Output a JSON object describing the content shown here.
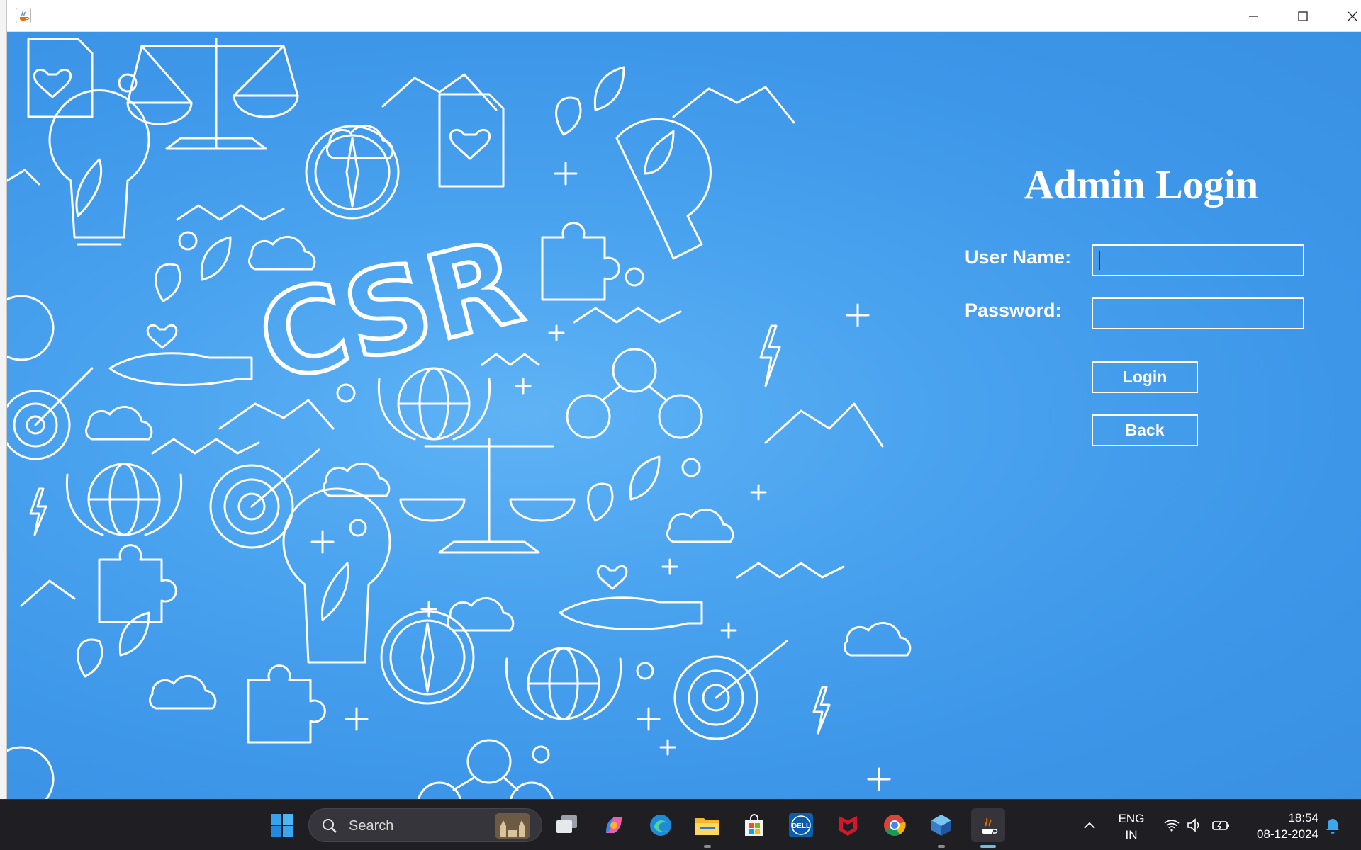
{
  "window": {
    "title": "",
    "icon": "java-cup-icon",
    "controls": [
      "minimize-icon",
      "maximize-icon",
      "close-icon"
    ]
  },
  "background": {
    "logo_text": "CSR",
    "colors": {
      "primary": "#4aa3ef",
      "light": "#5fb3f5",
      "line": "#ffffff"
    }
  },
  "login": {
    "title": "Admin Login",
    "username_label": "User Name:",
    "username_value": "",
    "password_label": "Password:",
    "password_value": "",
    "login_button": "Login",
    "back_button": "Back"
  },
  "taskbar": {
    "search_placeholder": "Search",
    "apps": [
      "windows-start-icon",
      "search-icon",
      "task-view-icon",
      "copilot-icon",
      "edge-icon",
      "file-explorer-icon",
      "microsoft-store-icon",
      "dell-icon",
      "mcafee-icon",
      "chrome-icon",
      "netbeans-icon",
      "java-icon"
    ],
    "tray": {
      "language": "ENG",
      "region": "IN",
      "time": "18:54",
      "date": "08-12-2024",
      "icons": [
        "chevron-up-icon",
        "wifi-icon",
        "volume-icon",
        "battery-icon",
        "bell-icon"
      ]
    }
  }
}
